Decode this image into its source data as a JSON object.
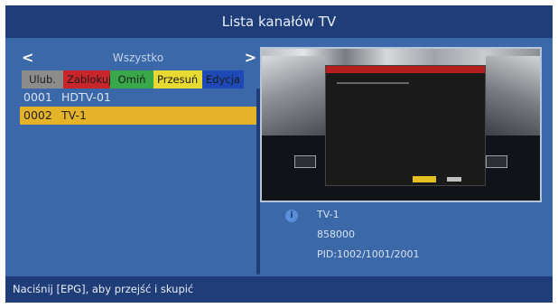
{
  "header": {
    "title": "Lista kanałów TV"
  },
  "group": {
    "name": "Wszystko",
    "prev_icon": "chevron-left-icon",
    "next_icon": "chevron-right-icon"
  },
  "color_buttons": [
    {
      "label": "Ulub.",
      "color": "#8c8c8c"
    },
    {
      "label": "Zablokuj",
      "color": "#c8262b"
    },
    {
      "label": "Omiń",
      "color": "#38a84a"
    },
    {
      "label": "Przesuń",
      "color": "#e8d832"
    },
    {
      "label": "Edycja",
      "color": "#1e4ab8"
    }
  ],
  "channels": [
    {
      "number": "0001",
      "name": "HDTV-01",
      "selected": false
    },
    {
      "number": "0002",
      "name": "TV-1",
      "selected": true
    }
  ],
  "info": {
    "icon": "info-icon",
    "channel_name": "TV-1",
    "frequency": "858000",
    "pid": "PID:1002/1001/2001"
  },
  "footer": {
    "hint": "Naciśnij [EPG], aby przejść i skupić"
  },
  "colors": {
    "background": "#3a68a8",
    "bar": "#1f3d78",
    "selection": "#e4b32a"
  }
}
